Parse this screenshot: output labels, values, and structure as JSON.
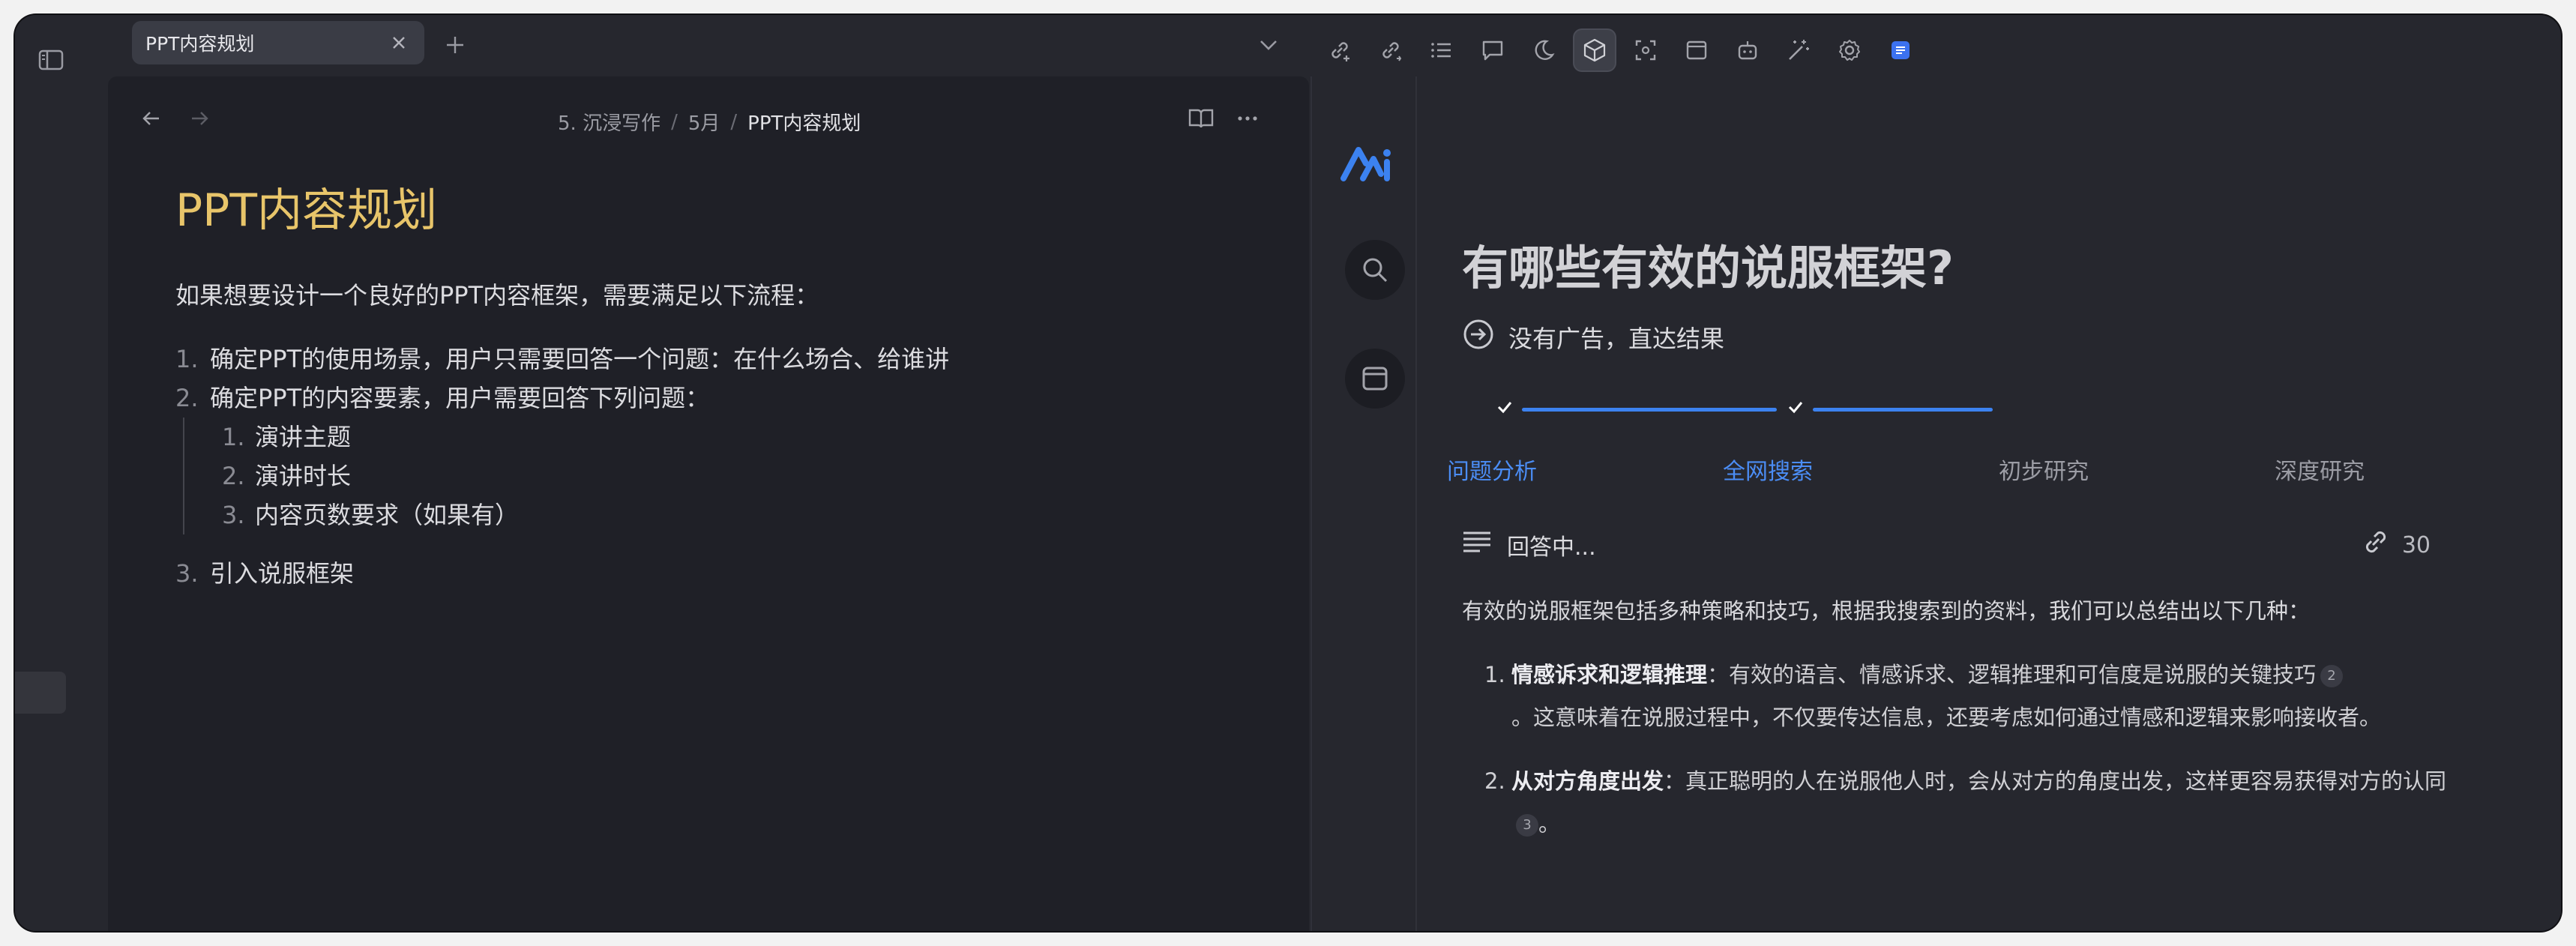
{
  "tab": {
    "title": "PPT内容规划"
  },
  "editor": {
    "breadcrumb": [
      "5. 沉浸写作",
      "5月",
      "PPT内容规划"
    ],
    "doc_title": "PPT内容规划",
    "intro": "如果想要设计一个良好的PPT内容框架，需要满足以下流程：",
    "list": [
      {
        "num": "1.",
        "text": "确定PPT的使用场景，用户只需要回答一个问题：在什么场合、给谁讲"
      },
      {
        "num": "2.",
        "text": "确定PPT的内容要素，用户需要回答下列问题："
      },
      {
        "num": "3.",
        "text": "引入说服框架"
      }
    ],
    "sublist": [
      {
        "num": "1.",
        "text": "演讲主题"
      },
      {
        "num": "2.",
        "text": "演讲时长"
      },
      {
        "num": "3.",
        "text": "内容页数要求（如果有）"
      }
    ]
  },
  "toolbar": {
    "icons": [
      "link-plus-icon",
      "link-add-icon",
      "list-icon",
      "comment-icon",
      "moon-icon",
      "cube-icon",
      "scan-icon",
      "browser-icon",
      "bot-icon",
      "magic-wand-icon",
      "gear-icon",
      "note-app-icon"
    ],
    "active_index": 5
  },
  "ai": {
    "question": "有哪些有效的说服框架?",
    "subline": "没有广告，直达结果",
    "steps": [
      {
        "label": "问题分析",
        "status": "done"
      },
      {
        "label": "全网搜索",
        "status": "done"
      },
      {
        "label": "初步研究",
        "status": "todo"
      },
      {
        "label": "深度研究",
        "status": "todo"
      }
    ],
    "answer_status": "回答中...",
    "source_count": "30",
    "intro": "有效的说服框架包括多种策略和技巧，根据我搜索到的资料，我们可以总结出以下几种：",
    "items": [
      {
        "num": "1.",
        "bold": "情感诉求和逻辑推理",
        "text1": "：有效的语言、情感诉求、逻辑推理和可信度是说服的关键技巧",
        "cite": "2",
        "text2": "。这意味着在说服过程中，不仅要传达信息，还要考虑如何通过情感和逻辑来影响接收者。"
      },
      {
        "num": "2.",
        "bold": "从对方角度出发",
        "text1": "：真正聪明的人在说服他人时，会从对方的角度出发，这样更容易获得对方的认同",
        "cite": "3",
        "text2": "。"
      }
    ],
    "colors": {
      "accent": "#3c82f0",
      "doc_title": "#e8c56a"
    }
  }
}
